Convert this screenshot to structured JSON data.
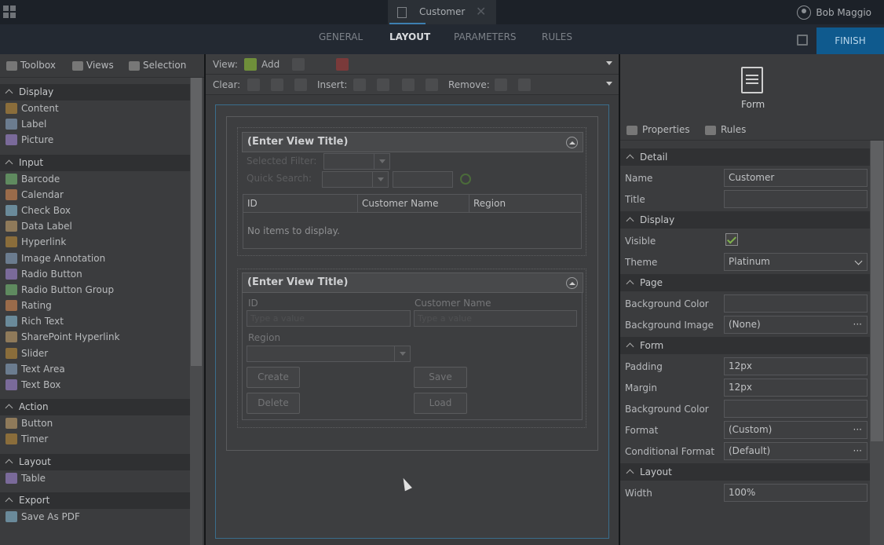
{
  "topbar": {
    "tab_title": "Customer",
    "tab_close": "✕",
    "user_name": "Bob Maggio"
  },
  "nav": {
    "tabs": [
      "GENERAL",
      "LAYOUT",
      "PARAMETERS",
      "RULES"
    ],
    "active": "LAYOUT",
    "finish_label": "FINISH"
  },
  "left_panel": {
    "tabs": [
      "Toolbox",
      "Views",
      "Selection"
    ],
    "categories": [
      {
        "name": "Display",
        "items": [
          "Content",
          "Label",
          "Picture"
        ]
      },
      {
        "name": "Input",
        "items": [
          "Barcode",
          "Calendar",
          "Check Box",
          "Data Label",
          "Hyperlink",
          "Image Annotation",
          "Radio Button",
          "Radio Button Group",
          "Rating",
          "Rich Text",
          "SharePoint Hyperlink",
          "Slider",
          "Text Area",
          "Text Box"
        ]
      },
      {
        "name": "Action",
        "items": [
          "Button",
          "Timer"
        ]
      },
      {
        "name": "Layout",
        "items": [
          "Table"
        ]
      },
      {
        "name": "Export",
        "items": [
          "Save As PDF"
        ]
      }
    ]
  },
  "toolbar": {
    "view_label": "View:",
    "add_label": "Add",
    "clear_label": "Clear:",
    "insert_label": "Insert:",
    "remove_label": "Remove:"
  },
  "view1": {
    "title": "(Enter View Title)",
    "selected_filter": "Selected Filter:",
    "quick_search": "Quick Search:",
    "columns": [
      "ID",
      "Customer Name",
      "Region"
    ],
    "empty_text": "No items to display."
  },
  "view2": {
    "title": "(Enter View Title)",
    "id_label": "ID",
    "name_label": "Customer Name",
    "region_label": "Region",
    "placeholder": "Type a value",
    "buttons": {
      "create": "Create",
      "save": "Save",
      "delete": "Delete",
      "load": "Load"
    }
  },
  "right_panel": {
    "header": "Form",
    "tabs": [
      "Properties",
      "Rules"
    ],
    "sections": {
      "detail": "Detail",
      "display": "Display",
      "page": "Page",
      "form": "Form",
      "layout": "Layout"
    },
    "props": {
      "name_label": "Name",
      "name_value": "Customer",
      "title_label": "Title",
      "title_value": "",
      "visible_label": "Visible",
      "theme_label": "Theme",
      "theme_value": "Platinum",
      "bg_color_label": "Background Color",
      "bg_color_value": "",
      "bg_image_label": "Background Image",
      "bg_image_value": "(None)",
      "padding_label": "Padding",
      "padding_value": "12px",
      "margin_label": "Margin",
      "margin_value": "12px",
      "form_bg_color_label": "Background Color",
      "form_bg_color_value": "",
      "format_label": "Format",
      "format_value": "(Custom)",
      "cond_format_label": "Conditional Format",
      "cond_format_value": "(Default)",
      "width_label": "Width",
      "width_value": "100%"
    }
  }
}
